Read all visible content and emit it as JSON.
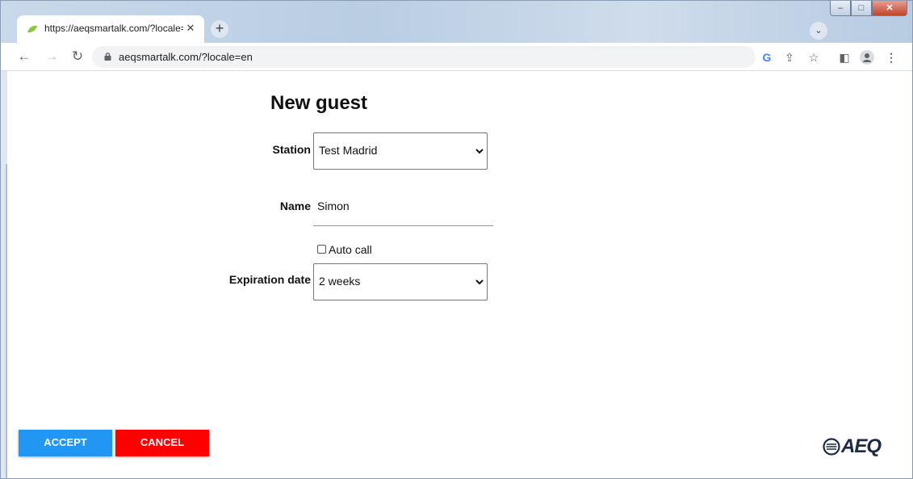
{
  "browser": {
    "tab_title": "https://aeqsmartalk.com/?locale=",
    "url": "aeqsmartalk.com/?locale=en"
  },
  "form": {
    "title": "New guest",
    "station_label": "Station",
    "station_value": "Test Madrid",
    "name_label": "Name",
    "name_value": "Simon",
    "auto_call_label": "Auto call",
    "auto_call_checked": false,
    "expiration_label": "Expiration date",
    "expiration_value": "2 weeks"
  },
  "buttons": {
    "accept": "ACCEPT",
    "cancel": "CANCEL"
  },
  "logo": {
    "text": "AEQ"
  },
  "colors": {
    "accept": "#2196f3",
    "cancel": "#ff0000"
  }
}
